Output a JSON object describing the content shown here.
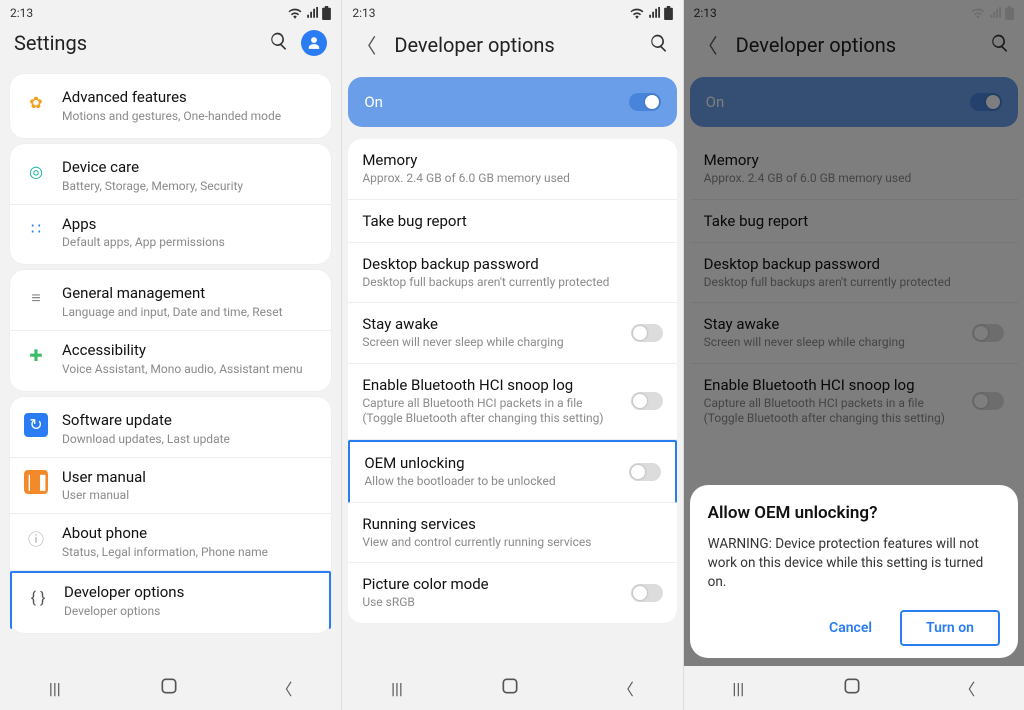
{
  "status": {
    "time": "2:13"
  },
  "colors": {
    "accent": "#2a7cf3",
    "highlight_border": "#2a7cf3"
  },
  "screen1": {
    "title": "Settings",
    "groups": [
      [
        {
          "icon": "gear-icon",
          "title": "Advanced features",
          "sub": "Motions and gestures, One-handed mode"
        }
      ],
      [
        {
          "icon": "device-care-icon",
          "title": "Device care",
          "sub": "Battery, Storage, Memory, Security"
        },
        {
          "icon": "apps-icon",
          "title": "Apps",
          "sub": "Default apps, App permissions"
        }
      ],
      [
        {
          "icon": "sliders-icon",
          "title": "General management",
          "sub": "Language and input, Date and time, Reset"
        },
        {
          "icon": "accessibility-icon",
          "title": "Accessibility",
          "sub": "Voice Assistant, Mono audio, Assistant menu"
        }
      ],
      [
        {
          "icon": "sync-icon",
          "title": "Software update",
          "sub": "Download updates, Last update"
        },
        {
          "icon": "manual-icon",
          "title": "User manual",
          "sub": "User manual"
        },
        {
          "icon": "info-icon",
          "title": "About phone",
          "sub": "Status, Legal information, Phone name"
        },
        {
          "icon": "braces-icon",
          "title": "Developer options",
          "sub": "Developer options",
          "highlighted": true
        }
      ]
    ]
  },
  "screen2": {
    "title": "Developer options",
    "banner": {
      "label": "On",
      "on": true
    },
    "items": [
      {
        "title": "Memory",
        "sub": "Approx. 2.4 GB of 6.0 GB memory used"
      },
      {
        "title": "Take bug report",
        "sub": ""
      },
      {
        "title": "Desktop backup password",
        "sub": "Desktop full backups aren't currently protected"
      },
      {
        "title": "Stay awake",
        "sub": "Screen will never sleep while charging",
        "toggle": false
      },
      {
        "title": "Enable Bluetooth HCI snoop log",
        "sub": "Capture all Bluetooth HCI packets in a file (Toggle Bluetooth after changing this setting)",
        "toggle": false
      },
      {
        "title": "OEM unlocking",
        "sub": "Allow the bootloader to be unlocked",
        "toggle": false,
        "highlighted": true
      },
      {
        "title": "Running services",
        "sub": "View and control currently running services"
      },
      {
        "title": "Picture color mode",
        "sub": "Use sRGB",
        "toggle": false
      }
    ]
  },
  "screen3": {
    "title": "Developer options",
    "banner": {
      "label": "On",
      "on": true
    },
    "items": [
      {
        "title": "Memory",
        "sub": "Approx. 2.4 GB of 6.0 GB memory used"
      },
      {
        "title": "Take bug report",
        "sub": ""
      },
      {
        "title": "Desktop backup password",
        "sub": "Desktop full backups aren't currently protected"
      },
      {
        "title": "Stay awake",
        "sub": "Screen will never sleep while charging",
        "toggle": false
      },
      {
        "title": "Enable Bluetooth HCI snoop log",
        "sub": "Capture all Bluetooth HCI packets in a file (Toggle Bluetooth after changing this setting)",
        "toggle": false
      }
    ],
    "dialog": {
      "title": "Allow OEM unlocking?",
      "body": "WARNING: Device protection features will not work on this device while this setting is turned on.",
      "cancel": "Cancel",
      "confirm": "Turn on"
    }
  }
}
